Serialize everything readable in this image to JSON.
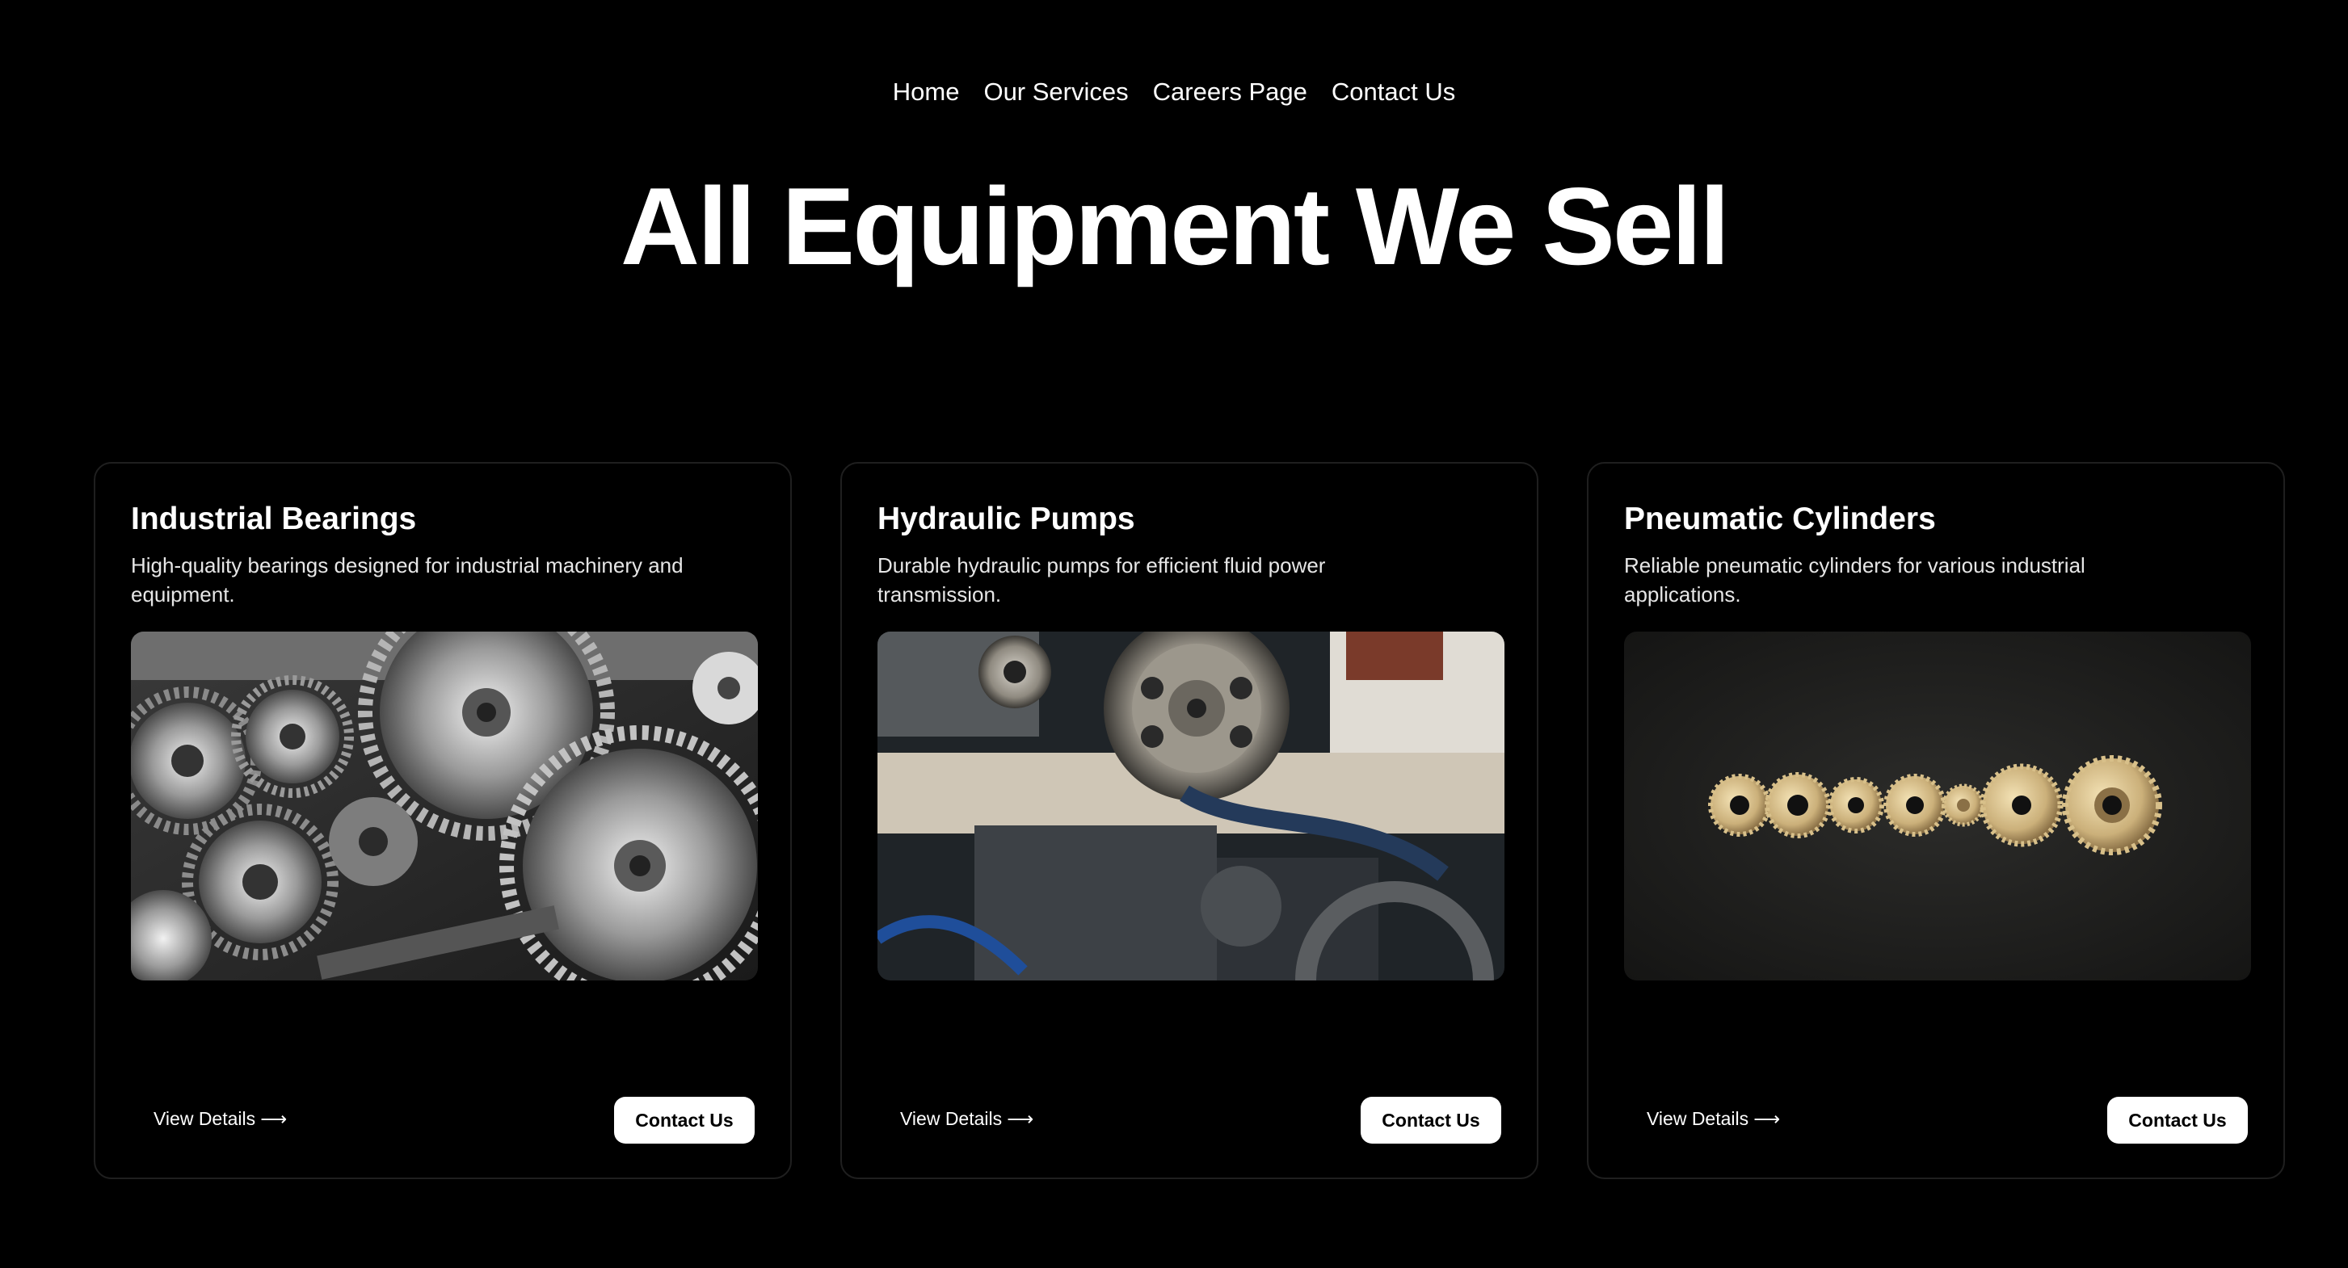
{
  "nav": {
    "items": [
      {
        "label": "Home"
      },
      {
        "label": "Our Services"
      },
      {
        "label": "Careers Page"
      },
      {
        "label": "Contact Us"
      }
    ]
  },
  "hero": {
    "title": "All Equipment We Sell"
  },
  "cards": [
    {
      "title": "Industrial Bearings",
      "description": "High-quality bearings designed for industrial machinery and equipment.",
      "image_icon": "gears-machinery-photo",
      "view_label": "View Details",
      "arrow": "⟶",
      "contact_label": "Contact Us"
    },
    {
      "title": "Hydraulic Pumps",
      "description": "Durable hydraulic pumps for efficient fluid power transmission.",
      "image_icon": "engine-pulley-photo",
      "view_label": "View Details",
      "arrow": "⟶",
      "contact_label": "Contact Us"
    },
    {
      "title": "Pneumatic Cylinders",
      "description": "Reliable pneumatic cylinders for various industrial applications.",
      "image_icon": "golden-gears-row-photo",
      "view_label": "View Details",
      "arrow": "⟶",
      "contact_label": "Contact Us"
    }
  ],
  "colors": {
    "background": "#000000",
    "text": "#ffffff",
    "card_border": "#1f1f1f",
    "button_bg": "#ffffff",
    "button_text": "#000000"
  }
}
